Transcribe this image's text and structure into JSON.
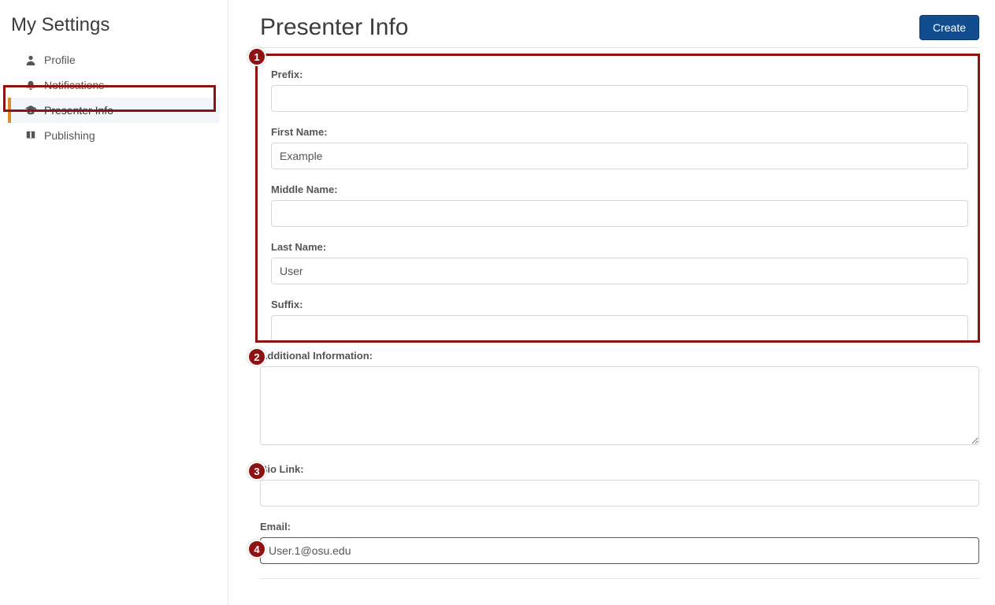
{
  "sidebar": {
    "title": "My Settings",
    "items": [
      {
        "label": "Profile",
        "icon": "person-icon",
        "active": false
      },
      {
        "label": "Notifications",
        "icon": "bell-icon",
        "active": false
      },
      {
        "label": "Presenter Info",
        "icon": "grad-cap-icon",
        "active": true
      },
      {
        "label": "Publishing",
        "icon": "book-icon",
        "active": false
      }
    ]
  },
  "main": {
    "title": "Presenter Info",
    "create_label": "Create",
    "callouts": {
      "c1": "1",
      "c2": "2",
      "c3": "3",
      "c4": "4"
    },
    "fields": {
      "prefix": {
        "label": "Prefix:",
        "value": ""
      },
      "first_name": {
        "label": "First Name:",
        "value": "Example"
      },
      "middle_name": {
        "label": "Middle Name:",
        "value": ""
      },
      "last_name": {
        "label": "Last Name:",
        "value": "User"
      },
      "suffix": {
        "label": "Suffix:",
        "value": ""
      },
      "additional": {
        "label": "Additional Information:",
        "value": ""
      },
      "bio_link": {
        "label": "Bio Link:",
        "value": ""
      },
      "email": {
        "label": "Email:",
        "value": "User.1@osu.edu"
      }
    }
  }
}
